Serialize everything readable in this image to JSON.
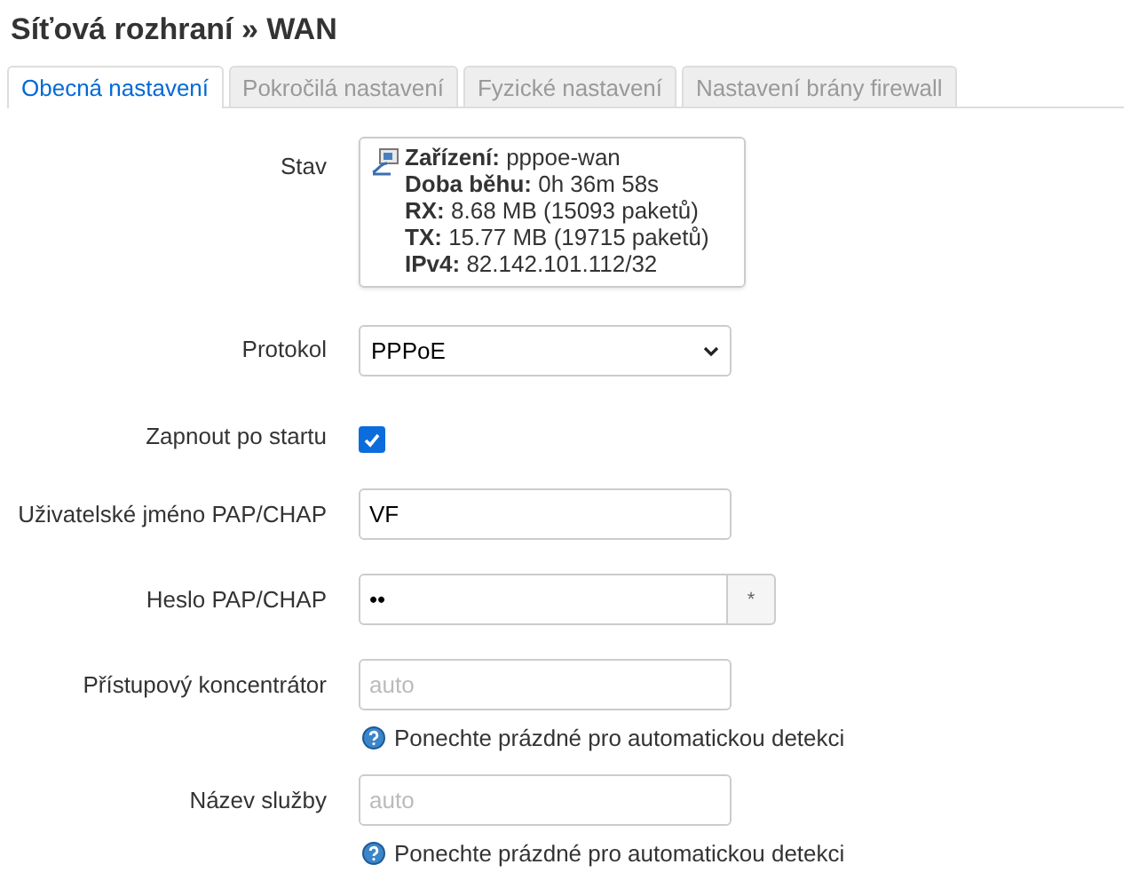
{
  "title": "Síťová rozhraní » WAN",
  "tabs": [
    {
      "label": "Obecná nastavení",
      "selected": true
    },
    {
      "label": "Pokročilá nastavení",
      "selected": false
    },
    {
      "label": "Fyzické nastavení",
      "selected": false
    },
    {
      "label": "Nastavení brány firewall",
      "selected": false
    }
  ],
  "fields": [
    {
      "kind": "status",
      "label": "Stav",
      "lines": [
        "**Zařízení:** pppoe-wan",
        "**Doba běhu:** 0h 36m 58s",
        "**RX:** 8.68 MB (15093 paketů)",
        "**TX:** 15.77 MB (19715 paketů)",
        "**IPv4:** 82.142.101.112/32"
      ]
    },
    {
      "kind": "select",
      "label": "Protokol",
      "value": "PPPoE"
    },
    {
      "kind": "checkbox",
      "label": "Zapnout po startu",
      "checked": true
    },
    {
      "kind": "text",
      "label": "Uživatelské jméno PAP/CHAP",
      "value": "VF"
    },
    {
      "kind": "password",
      "label": "Heslo PAP/CHAP",
      "value": "••",
      "reveal": "*"
    },
    {
      "kind": "text",
      "label": "Přístupový koncentrátor",
      "placeholder": "auto",
      "hint": "Ponechte prázdné pro automatickou detekci"
    },
    {
      "kind": "text",
      "label": "Název služby",
      "placeholder": "auto",
      "hint": "Ponechte prázdné pro automatickou detekci"
    }
  ]
}
